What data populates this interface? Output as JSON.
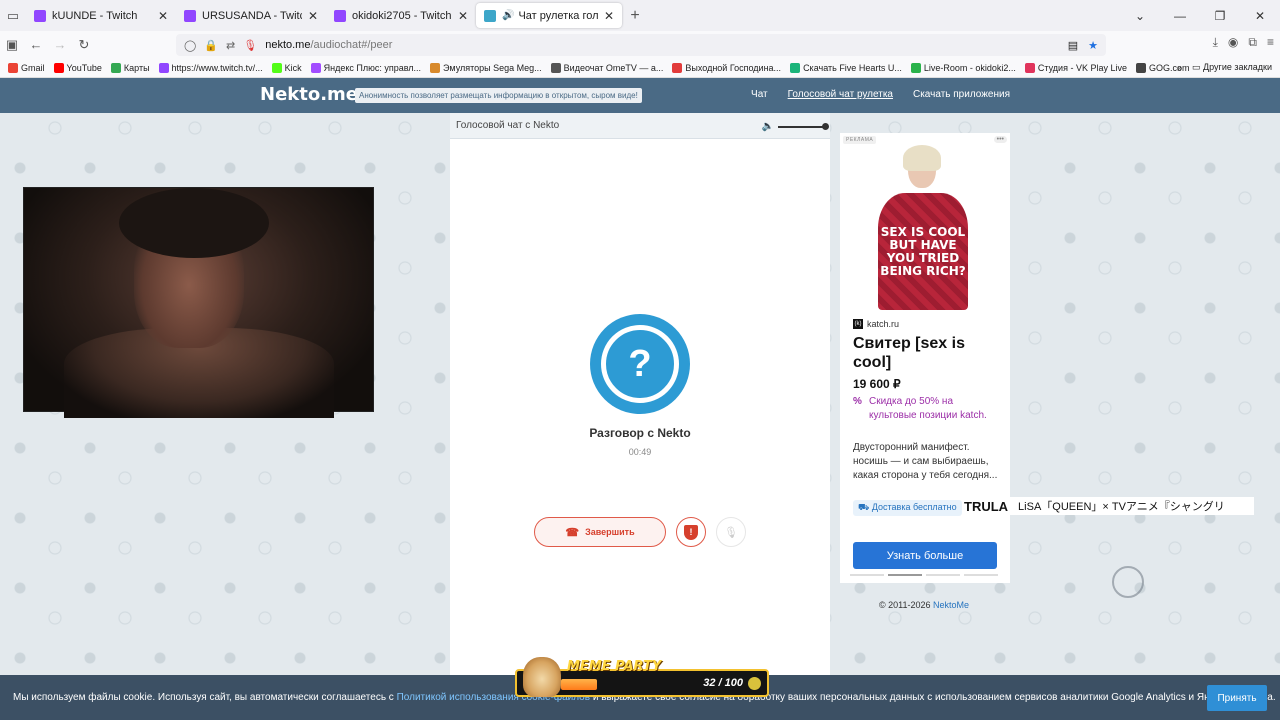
{
  "browser": {
    "tabs": [
      {
        "label": "kUUNDE - Twitch"
      },
      {
        "label": "URSUSANDA - Twitch"
      },
      {
        "label": "okidoki2705 - Twitch"
      },
      {
        "label": "Чат рулетка голосовая — Ne"
      }
    ],
    "url_host": "nekto.me",
    "url_path": "/audiochat#/peer",
    "bookmarks": [
      {
        "label": "Gmail",
        "color": "#ea4335"
      },
      {
        "label": "YouTube",
        "color": "#ff0000"
      },
      {
        "label": "Карты",
        "color": "#34a853"
      },
      {
        "label": "https://www.twitch.tv/...",
        "color": "#9146ff"
      },
      {
        "label": "Kick",
        "color": "#53fc18"
      },
      {
        "label": "Яндекс Плюс: управл...",
        "color": "#a24dff"
      },
      {
        "label": "Эмуляторы Sega Meg...",
        "color": "#d88a2c"
      },
      {
        "label": "Видеочат OmeTV — а...",
        "color": "#555555"
      },
      {
        "label": "Выходной Господина...",
        "color": "#e23b3b"
      },
      {
        "label": "Скачать Five Hearts U...",
        "color": "#1bb47a"
      },
      {
        "label": "Live-Room - okidoki2...",
        "color": "#2ab24b"
      },
      {
        "label": "Студия - VK Play Live",
        "color": "#e0345c"
      },
      {
        "label": "GOG.com",
        "color": "#444444"
      }
    ],
    "other_bookmarks": "Другие закладки"
  },
  "site": {
    "logo": "Nekto.me",
    "tagline": "Анонимность позволяет размещать информацию в открытом, сыром виде!",
    "nav": [
      "Чат",
      "Голосовой чат рулетка",
      "Скачать приложения"
    ]
  },
  "chat": {
    "header": "Голосовой чат с Nekto",
    "avatar_symbol": "?",
    "title": "Разговор с Nekto",
    "timer": "00:49",
    "end_button": "Завершить",
    "report_symbol": "!",
    "volume_level": 1.0
  },
  "ad": {
    "label": "РЕКЛАМА",
    "more": "•••",
    "image_text": "SEX IS COOL BUT HAVE YOU TRIED BEING RICH?",
    "brand_icon": "(k)",
    "domain": "katch.ru",
    "title": "Свитер [sex is cool]",
    "price": "19 600 ₽",
    "discount_symbol": "%",
    "discount": "Скидка до 50% на культовые позиции katch.",
    "description": "Двусторонний манифест. носишь — и сам выбираешь, какая сторона у тебя сегодня...",
    "delivery": "Доставка бесплатно",
    "cta": "Узнать больше"
  },
  "footer": {
    "copyright": "© 2011-2026",
    "link": "NektoMe"
  },
  "overlay": {
    "brand": "TRULA",
    "song": "LiSA「QUEEN」× TVアニメ『シャングリ"
  },
  "meme_party": {
    "title": "MEME PARTY",
    "count": "32 / 100"
  },
  "cookie": {
    "text_before": "Мы используем файлы cookie. Используя сайт, вы автоматически соглашаетесь с ",
    "link": "Политикой использования cookie-файлов",
    "text_after": " и выражаете своё согласие на обработку ваших персональных данных с использованием сервисов аналитики Google Analytics и Яндекс Метрика.",
    "accept": "Принять"
  }
}
